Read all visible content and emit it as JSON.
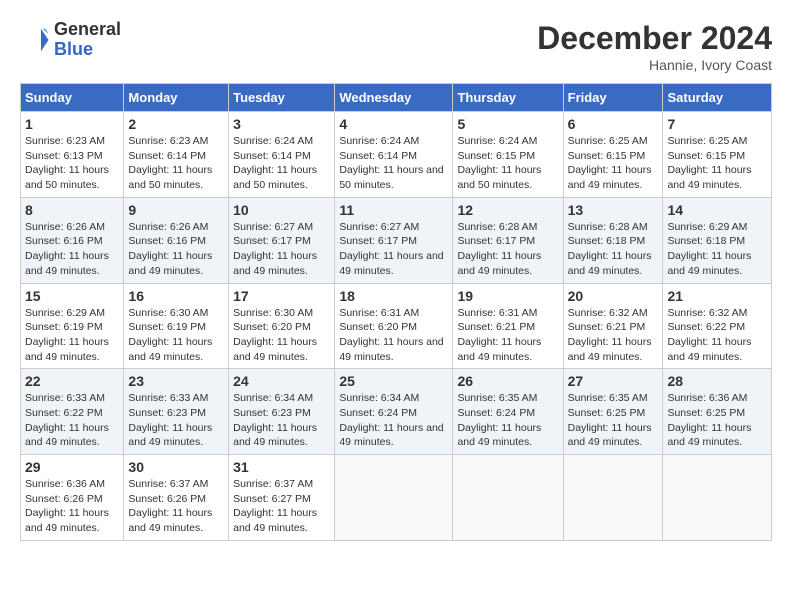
{
  "logo": {
    "line1": "General",
    "line2": "Blue"
  },
  "title": "December 2024",
  "location": "Hannie, Ivory Coast",
  "weekdays": [
    "Sunday",
    "Monday",
    "Tuesday",
    "Wednesday",
    "Thursday",
    "Friday",
    "Saturday"
  ],
  "weeks": [
    [
      {
        "day": "1",
        "sunrise": "Sunrise: 6:23 AM",
        "sunset": "Sunset: 6:13 PM",
        "daylight": "Daylight: 11 hours and 50 minutes."
      },
      {
        "day": "2",
        "sunrise": "Sunrise: 6:23 AM",
        "sunset": "Sunset: 6:14 PM",
        "daylight": "Daylight: 11 hours and 50 minutes."
      },
      {
        "day": "3",
        "sunrise": "Sunrise: 6:24 AM",
        "sunset": "Sunset: 6:14 PM",
        "daylight": "Daylight: 11 hours and 50 minutes."
      },
      {
        "day": "4",
        "sunrise": "Sunrise: 6:24 AM",
        "sunset": "Sunset: 6:14 PM",
        "daylight": "Daylight: 11 hours and 50 minutes."
      },
      {
        "day": "5",
        "sunrise": "Sunrise: 6:24 AM",
        "sunset": "Sunset: 6:15 PM",
        "daylight": "Daylight: 11 hours and 50 minutes."
      },
      {
        "day": "6",
        "sunrise": "Sunrise: 6:25 AM",
        "sunset": "Sunset: 6:15 PM",
        "daylight": "Daylight: 11 hours and 49 minutes."
      },
      {
        "day": "7",
        "sunrise": "Sunrise: 6:25 AM",
        "sunset": "Sunset: 6:15 PM",
        "daylight": "Daylight: 11 hours and 49 minutes."
      }
    ],
    [
      {
        "day": "8",
        "sunrise": "Sunrise: 6:26 AM",
        "sunset": "Sunset: 6:16 PM",
        "daylight": "Daylight: 11 hours and 49 minutes."
      },
      {
        "day": "9",
        "sunrise": "Sunrise: 6:26 AM",
        "sunset": "Sunset: 6:16 PM",
        "daylight": "Daylight: 11 hours and 49 minutes."
      },
      {
        "day": "10",
        "sunrise": "Sunrise: 6:27 AM",
        "sunset": "Sunset: 6:17 PM",
        "daylight": "Daylight: 11 hours and 49 minutes."
      },
      {
        "day": "11",
        "sunrise": "Sunrise: 6:27 AM",
        "sunset": "Sunset: 6:17 PM",
        "daylight": "Daylight: 11 hours and 49 minutes."
      },
      {
        "day": "12",
        "sunrise": "Sunrise: 6:28 AM",
        "sunset": "Sunset: 6:17 PM",
        "daylight": "Daylight: 11 hours and 49 minutes."
      },
      {
        "day": "13",
        "sunrise": "Sunrise: 6:28 AM",
        "sunset": "Sunset: 6:18 PM",
        "daylight": "Daylight: 11 hours and 49 minutes."
      },
      {
        "day": "14",
        "sunrise": "Sunrise: 6:29 AM",
        "sunset": "Sunset: 6:18 PM",
        "daylight": "Daylight: 11 hours and 49 minutes."
      }
    ],
    [
      {
        "day": "15",
        "sunrise": "Sunrise: 6:29 AM",
        "sunset": "Sunset: 6:19 PM",
        "daylight": "Daylight: 11 hours and 49 minutes."
      },
      {
        "day": "16",
        "sunrise": "Sunrise: 6:30 AM",
        "sunset": "Sunset: 6:19 PM",
        "daylight": "Daylight: 11 hours and 49 minutes."
      },
      {
        "day": "17",
        "sunrise": "Sunrise: 6:30 AM",
        "sunset": "Sunset: 6:20 PM",
        "daylight": "Daylight: 11 hours and 49 minutes."
      },
      {
        "day": "18",
        "sunrise": "Sunrise: 6:31 AM",
        "sunset": "Sunset: 6:20 PM",
        "daylight": "Daylight: 11 hours and 49 minutes."
      },
      {
        "day": "19",
        "sunrise": "Sunrise: 6:31 AM",
        "sunset": "Sunset: 6:21 PM",
        "daylight": "Daylight: 11 hours and 49 minutes."
      },
      {
        "day": "20",
        "sunrise": "Sunrise: 6:32 AM",
        "sunset": "Sunset: 6:21 PM",
        "daylight": "Daylight: 11 hours and 49 minutes."
      },
      {
        "day": "21",
        "sunrise": "Sunrise: 6:32 AM",
        "sunset": "Sunset: 6:22 PM",
        "daylight": "Daylight: 11 hours and 49 minutes."
      }
    ],
    [
      {
        "day": "22",
        "sunrise": "Sunrise: 6:33 AM",
        "sunset": "Sunset: 6:22 PM",
        "daylight": "Daylight: 11 hours and 49 minutes."
      },
      {
        "day": "23",
        "sunrise": "Sunrise: 6:33 AM",
        "sunset": "Sunset: 6:23 PM",
        "daylight": "Daylight: 11 hours and 49 minutes."
      },
      {
        "day": "24",
        "sunrise": "Sunrise: 6:34 AM",
        "sunset": "Sunset: 6:23 PM",
        "daylight": "Daylight: 11 hours and 49 minutes."
      },
      {
        "day": "25",
        "sunrise": "Sunrise: 6:34 AM",
        "sunset": "Sunset: 6:24 PM",
        "daylight": "Daylight: 11 hours and 49 minutes."
      },
      {
        "day": "26",
        "sunrise": "Sunrise: 6:35 AM",
        "sunset": "Sunset: 6:24 PM",
        "daylight": "Daylight: 11 hours and 49 minutes."
      },
      {
        "day": "27",
        "sunrise": "Sunrise: 6:35 AM",
        "sunset": "Sunset: 6:25 PM",
        "daylight": "Daylight: 11 hours and 49 minutes."
      },
      {
        "day": "28",
        "sunrise": "Sunrise: 6:36 AM",
        "sunset": "Sunset: 6:25 PM",
        "daylight": "Daylight: 11 hours and 49 minutes."
      }
    ],
    [
      {
        "day": "29",
        "sunrise": "Sunrise: 6:36 AM",
        "sunset": "Sunset: 6:26 PM",
        "daylight": "Daylight: 11 hours and 49 minutes."
      },
      {
        "day": "30",
        "sunrise": "Sunrise: 6:37 AM",
        "sunset": "Sunset: 6:26 PM",
        "daylight": "Daylight: 11 hours and 49 minutes."
      },
      {
        "day": "31",
        "sunrise": "Sunrise: 6:37 AM",
        "sunset": "Sunset: 6:27 PM",
        "daylight": "Daylight: 11 hours and 49 minutes."
      },
      null,
      null,
      null,
      null
    ]
  ]
}
